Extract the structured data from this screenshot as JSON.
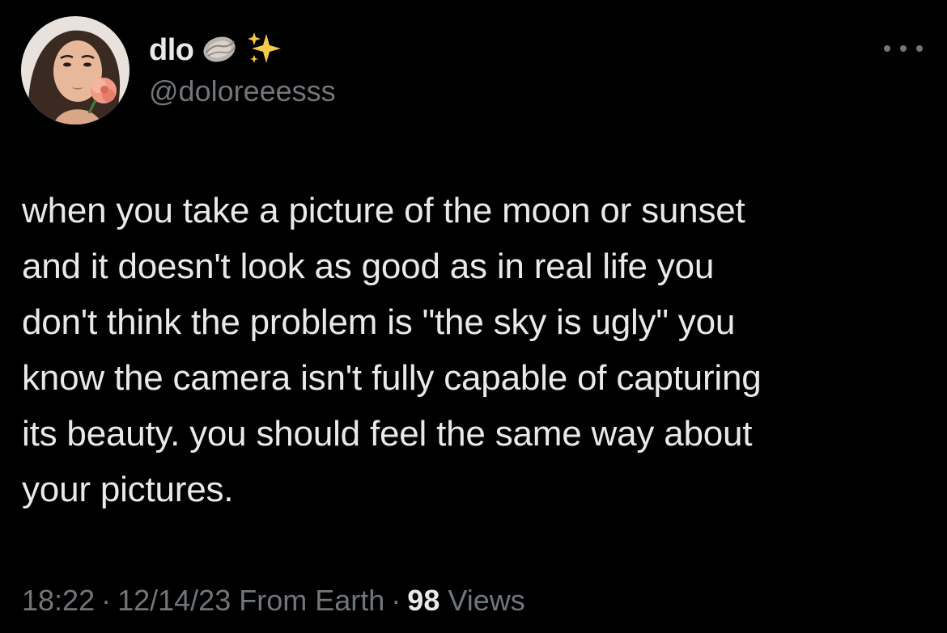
{
  "author": {
    "display_name": "dlo",
    "handle": "@doloreeesss",
    "name_emojis": [
      "oyster-icon",
      "sparkles-icon"
    ],
    "avatar": "avatar"
  },
  "more_menu": "more-options-icon",
  "tweet": {
    "text": "when you take a picture of the moon or sunset\nand it doesn't look as good as in real life you\ndon't think the problem is \"the sky is ugly\" you\nknow the camera isn't fully capable of capturing\nits beauty. you should feel the same way about\nyour pictures."
  },
  "meta": {
    "time": "18:22",
    "separator": "·",
    "date": "12/14/23",
    "source": "From Earth",
    "views_count": "98",
    "views_label": "Views"
  },
  "colors": {
    "background": "#000000",
    "primary_text": "#e7e9ea",
    "secondary_text": "#71767b"
  }
}
